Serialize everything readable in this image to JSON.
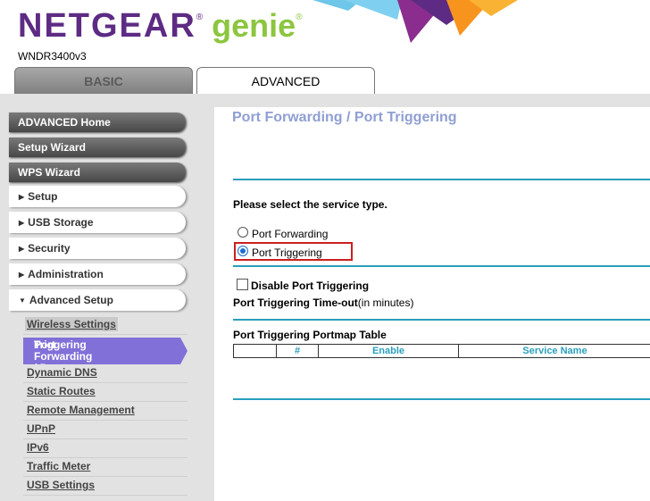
{
  "header": {
    "brand_name": "NETGEAR",
    "brand_reg": "®",
    "brand_genie": "genie",
    "genie_reg": "®",
    "model": "WNDR3400v3"
  },
  "tabs": [
    {
      "label": "BASIC",
      "active": false
    },
    {
      "label": "ADVANCED",
      "active": true
    }
  ],
  "sidebar": {
    "top_items": [
      {
        "label": "ADVANCED Home"
      },
      {
        "label": "Setup Wizard"
      },
      {
        "label": "WPS Wizard"
      }
    ],
    "sections": [
      {
        "label": "Setup",
        "expanded": false
      },
      {
        "label": "USB Storage",
        "expanded": false
      },
      {
        "label": "Security",
        "expanded": false
      },
      {
        "label": "Administration",
        "expanded": false
      },
      {
        "label": "Advanced Setup",
        "expanded": true
      }
    ],
    "sub_items": [
      {
        "label": "Wireless Settings"
      },
      {
        "label": "Port Forwarding / Port Triggering",
        "line1": "Port Forwarding / Port",
        "line2": "Triggering",
        "active": true
      },
      {
        "label": "Dynamic DNS"
      },
      {
        "label": "Static Routes"
      },
      {
        "label": "Remote Management"
      },
      {
        "label": "UPnP"
      },
      {
        "label": "IPv6"
      },
      {
        "label": "Traffic Meter"
      },
      {
        "label": "USB Settings"
      }
    ]
  },
  "main": {
    "title": "Port Forwarding / Port Triggering",
    "service_prompt": "Please select the service type.",
    "service_options": [
      {
        "label": "Port Forwarding",
        "selected": false
      },
      {
        "label": "Port Triggering",
        "selected": true
      }
    ],
    "disable_label": "Disable Port Triggering",
    "disable_checked": false,
    "timeout_label": "Port Triggering Time-out",
    "timeout_unit": "(in minutes)",
    "table_title": "Port Triggering Portmap Table",
    "table_headers": [
      "",
      "#",
      "Enable",
      "Service Name"
    ]
  },
  "colors": {
    "brand_purple": "#5d2b83",
    "brand_green": "#8cc63f",
    "accent_teal": "#2a9fbc",
    "active_nav": "#8170d8",
    "highlight_red": "#cc1f1f"
  }
}
